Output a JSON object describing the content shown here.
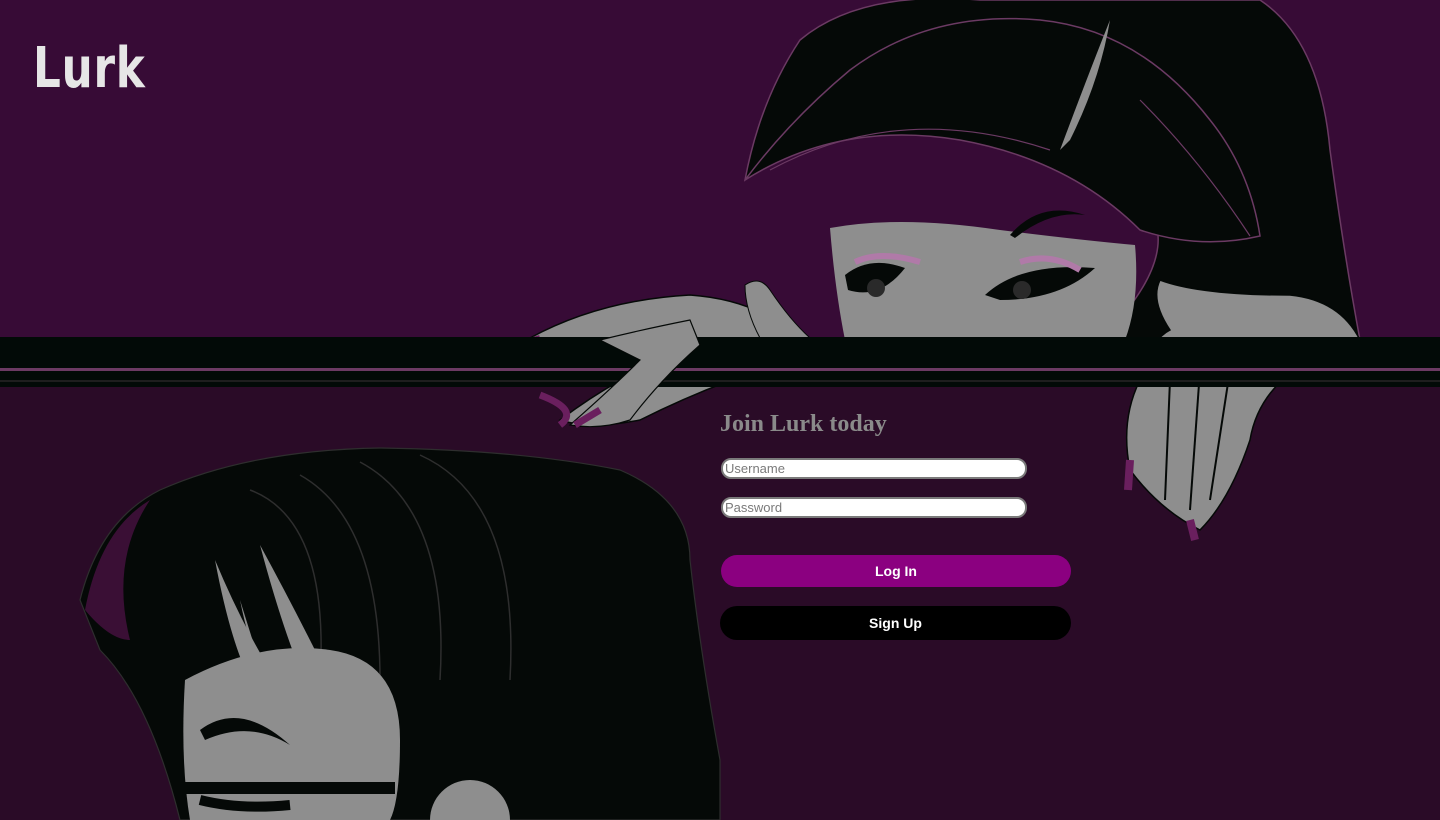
{
  "brand": {
    "name": "Lurk"
  },
  "signup_form": {
    "title": "Join Lurk today",
    "username_placeholder": "Username",
    "password_placeholder": "Password",
    "login_label": "Log In",
    "signup_label": "Sign Up"
  },
  "colors": {
    "background_top": "#370b36",
    "background_bottom": "#2a0b27",
    "ledge": "#020a07",
    "skin": "#8e8e8e",
    "login_button": "#8b0080",
    "signup_button": "#000000",
    "title_text": "#8a8a8a",
    "logo_text": "#e6e6e6"
  }
}
